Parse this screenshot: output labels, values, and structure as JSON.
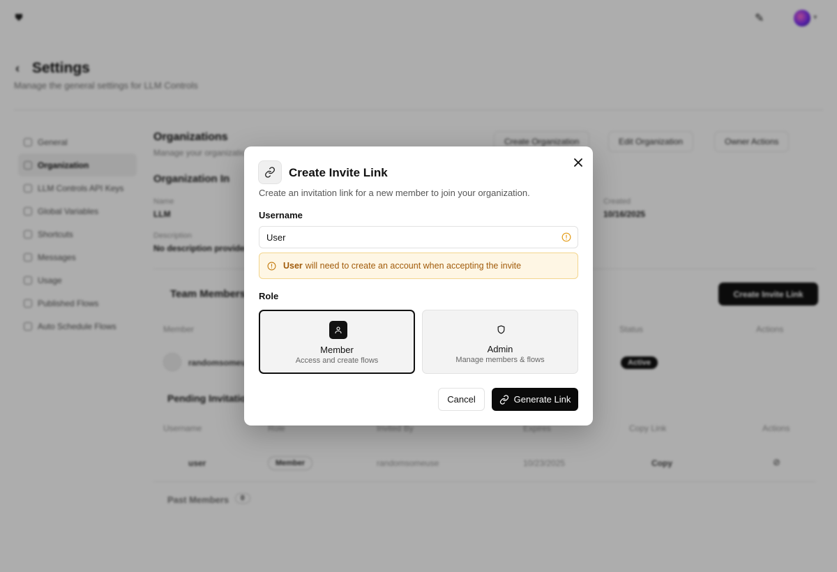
{
  "background": {
    "page": {
      "title": "Settings",
      "subtitle": "Manage the general settings for LLM Controls"
    },
    "sidebar": {
      "items": [
        {
          "label": "General"
        },
        {
          "label": "Organization"
        },
        {
          "label": "LLM Controls API Keys"
        },
        {
          "label": "Global Variables"
        },
        {
          "label": "Shortcuts"
        },
        {
          "label": "Messages"
        },
        {
          "label": "Usage"
        },
        {
          "label": "Published Flows"
        },
        {
          "label": "Auto Schedule Flows"
        }
      ],
      "active_index": 1
    },
    "header": {
      "title": "Organizations",
      "subtitle": "Manage your organization",
      "buttons": {
        "create_org": "Create Organization",
        "edit_org": "Edit Organization",
        "owner_actions": "Owner Actions"
      }
    },
    "org_info": {
      "heading": "Organization In",
      "name_label": "Name",
      "name_value": "LLM",
      "desc_label": "Description",
      "desc_value": "No description provided",
      "created_label": "Created",
      "created_value": "10/16/2025"
    },
    "team": {
      "heading": "Team Members",
      "create_invite_button": "Create Invite Link",
      "columns": {
        "member": "Member",
        "status": "Status",
        "actions": "Actions"
      },
      "rows": [
        {
          "member": "randomsomeu",
          "status": "Active"
        }
      ]
    },
    "pending": {
      "heading": "Pending Invitations",
      "columns": {
        "username": "Username",
        "role": "Role",
        "invited_by": "Invited By",
        "expires": "Expires",
        "copy_link": "Copy Link",
        "actions": "Actions"
      },
      "rows": [
        {
          "username": "user",
          "role": "Member",
          "invited_by": "randomsomeuse",
          "expires": "10/23/2025",
          "copy": "Copy"
        }
      ]
    },
    "past": {
      "heading": "Past Members",
      "count": "0"
    }
  },
  "modal": {
    "title": "Create Invite Link",
    "description": "Create an invitation link for a new member to join your organization.",
    "username_label": "Username",
    "username_value": "User",
    "alert": {
      "user": "User",
      "message": "will need to create an account when accepting the invite"
    },
    "role_label": "Role",
    "roles": [
      {
        "name": "Member",
        "description": "Access and create flows",
        "selected": true
      },
      {
        "name": "Admin",
        "description": "Manage members & flows",
        "selected": false
      }
    ],
    "cancel_label": "Cancel",
    "generate_label": "Generate Link"
  },
  "colors": {
    "accent": "#0a0a0a",
    "warning_bg": "#fef6e4",
    "warning_text": "#a15b0a",
    "warning_border": "#f3d58e"
  }
}
